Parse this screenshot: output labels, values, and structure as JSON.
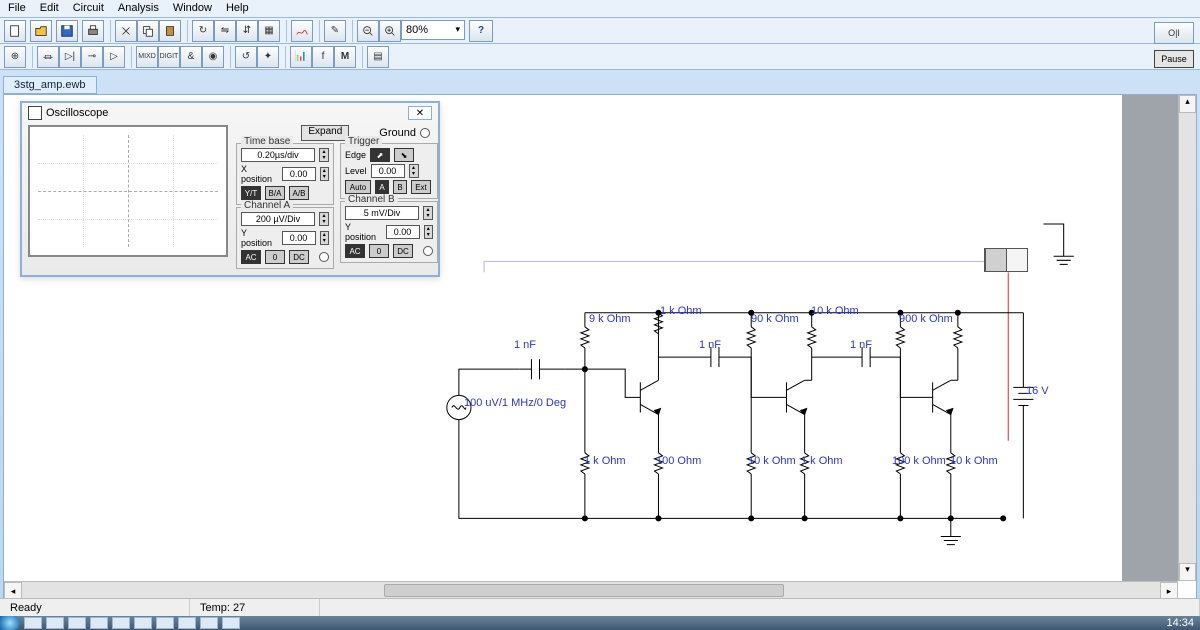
{
  "menubar": [
    "File",
    "Edit",
    "Circuit",
    "Analysis",
    "Window",
    "Help"
  ],
  "zoom": "80%",
  "doc_tab": "3stg_amp.ewb",
  "scope": {
    "title": "Oscilloscope",
    "expand": "Expand",
    "ground": "Ground",
    "timebase": {
      "label": "Time base",
      "scale": "0.20µs/div",
      "xpos_label": "X position",
      "xpos": "0.00",
      "bt_yt": "Y/T",
      "bt_ba": "B/A",
      "bt_ab": "A/B"
    },
    "trigger": {
      "label": "Trigger",
      "edge": "Edge",
      "level": "Level",
      "level_val": "0.00",
      "auto": "Auto",
      "a": "A",
      "b": "B",
      "ext": "Ext"
    },
    "chA": {
      "label": "Channel A",
      "scale": "200 µV/Div",
      "ypos": "Y position",
      "ypos_val": "0.00",
      "ac": "AC",
      "zero": "0",
      "dc": "DC"
    },
    "chB": {
      "label": "Channel B",
      "scale": "5 mV/Div",
      "ypos": "Y position",
      "ypos_val": "0.00",
      "ac": "AC",
      "zero": "0",
      "dc": "DC"
    }
  },
  "labels": {
    "src": "100 uV/1 MHz/0 Deg",
    "c1": "1 nF",
    "c2": "1 nF",
    "c3": "1 nF",
    "r1": "9 k Ohm",
    "r2": "1 k Ohm",
    "r3": "90 k Ohm",
    "r4": "10 k Ohm",
    "r5": "900 k Ohm",
    "r6": "1 k Ohm",
    "r7": "100  Ohm",
    "r8": "10 k Ohm",
    "r9": "1 k Ohm",
    "r10": "100 k Ohm",
    "r11": "10 k Ohm",
    "vbat": "16 V"
  },
  "status": {
    "ready": "Ready",
    "temp": "Temp:  27"
  },
  "clock": "14:34",
  "pause": "Pause"
}
